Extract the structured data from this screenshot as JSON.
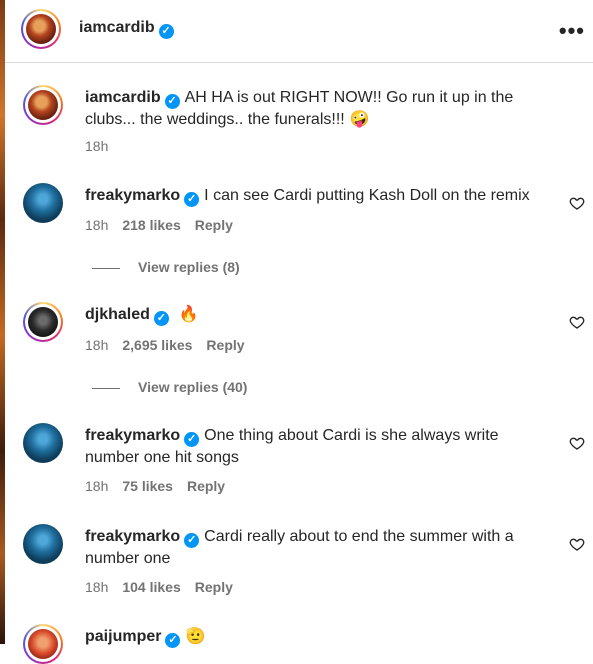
{
  "header": {
    "username": "iamcardib",
    "more_label": "•••"
  },
  "caption": {
    "username": "iamcardib",
    "text": "AH HA is out RIGHT NOW!! Go run it up in the clubs... the weddings.. the funerals!!!",
    "emoji": "🤪",
    "time": "18h"
  },
  "comments": [
    {
      "username": "freakymarko",
      "text": "I can see Cardi putting Kash Doll on the remix",
      "time": "18h",
      "likes": "218 likes",
      "reply_label": "Reply",
      "view_replies": "View replies (8)"
    },
    {
      "username": "djkhaled",
      "text": "",
      "emoji": "🔥",
      "time": "18h",
      "likes": "2,695 likes",
      "reply_label": "Reply",
      "view_replies": "View replies (40)"
    },
    {
      "username": "freakymarko",
      "text": "One thing about Cardi is she always write number one hit songs",
      "time": "18h",
      "likes": "75 likes",
      "reply_label": "Reply"
    },
    {
      "username": "freakymarko",
      "text": "Cardi really about to end the summer with a number one",
      "time": "18h",
      "likes": "104 likes",
      "reply_label": "Reply"
    },
    {
      "username": "paijumper",
      "emoji": "🫡"
    }
  ],
  "colors": {
    "verified": "#0095f6",
    "secondary_text": "#737373",
    "primary_text": "#262626"
  }
}
